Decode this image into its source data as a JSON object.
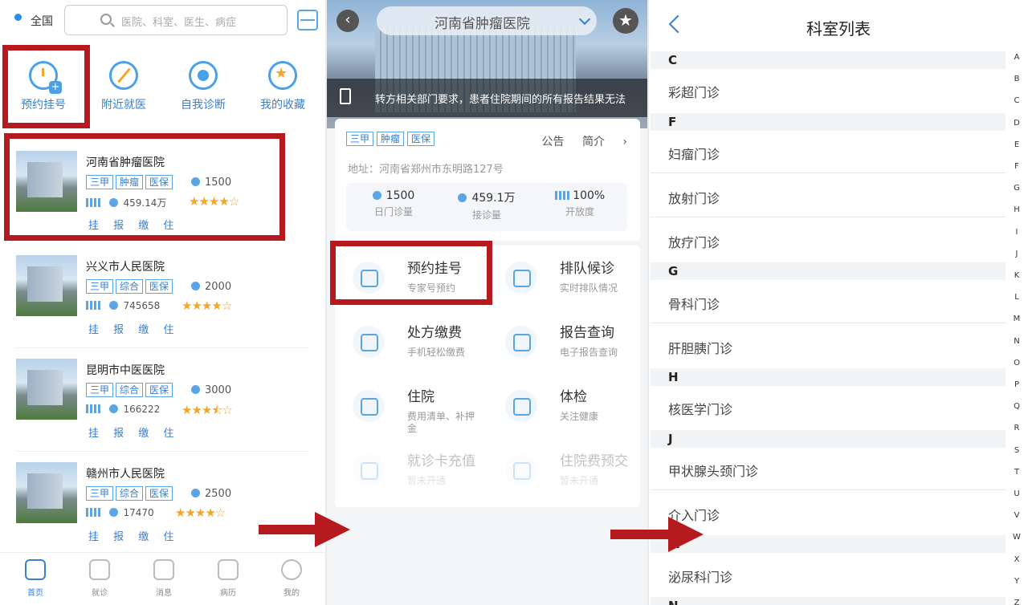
{
  "panel1": {
    "location": "全国",
    "search_placeholder": "医院、科室、医生、病症",
    "quick": [
      {
        "label": "预约挂号",
        "icon": "clock-plus-icon"
      },
      {
        "label": "附近就医",
        "icon": "compass-icon"
      },
      {
        "label": "自我诊断",
        "icon": "target-icon"
      },
      {
        "label": "我的收藏",
        "icon": "star-icon"
      }
    ],
    "hospitals": [
      {
        "name": "河南省肿瘤医院",
        "tags": [
          "三甲",
          "肿瘤",
          "医保"
        ],
        "visits": "1500",
        "count": "459.14万",
        "stars": "★★★★☆",
        "actions": "挂 报 缴 住"
      },
      {
        "name": "兴义市人民医院",
        "tags": [
          "三甲",
          "综合",
          "医保"
        ],
        "visits": "2000",
        "count": "745658",
        "stars": "★★★★☆",
        "actions": "挂 报 缴 住"
      },
      {
        "name": "昆明市中医医院",
        "tags": [
          "三甲",
          "综合",
          "医保"
        ],
        "visits": "3000",
        "count": "166222",
        "stars": "★★★⯪☆",
        "actions": "挂 报 缴 住"
      },
      {
        "name": "赣州市人民医院",
        "tags": [
          "三甲",
          "综合",
          "医保"
        ],
        "visits": "2500",
        "count": "17470",
        "stars": "★★★★☆",
        "actions": "挂 报 缴 住"
      }
    ],
    "tabs": [
      "首页",
      "就诊",
      "消息",
      "病历",
      "我的"
    ]
  },
  "panel2": {
    "title": "河南省肿瘤医院",
    "notice": "转方相关部门要求，患者住院期间的所有报告结果无法",
    "tags": [
      "三甲",
      "肿瘤",
      "医保"
    ],
    "links": "公告 简介 ›",
    "address": "地址：河南省郑州市东明路127号",
    "stats": [
      {
        "value": "1500",
        "label": "日门诊量"
      },
      {
        "value": "459.1万",
        "label": "接诊量"
      },
      {
        "value": "100%",
        "label": "开放度"
      }
    ],
    "services": [
      {
        "title": "预约挂号",
        "sub": "专家号预约"
      },
      {
        "title": "排队候诊",
        "sub": "实时排队情况"
      },
      {
        "title": "处方缴费",
        "sub": "手机轻松缴费"
      },
      {
        "title": "报告查询",
        "sub": "电子报告查询"
      },
      {
        "title": "住院",
        "sub": "费用清单、补押金"
      },
      {
        "title": "体检",
        "sub": "关注健康"
      },
      {
        "title": "就诊卡充值",
        "sub": "暂未开通"
      },
      {
        "title": "住院费预交",
        "sub": "暂未开通"
      }
    ]
  },
  "panel3": {
    "title": "科室列表",
    "sections": [
      {
        "letter": "C",
        "items": [
          "彩超门诊"
        ]
      },
      {
        "letter": "F",
        "items": [
          "妇瘤门诊",
          "放射门诊",
          "放疗门诊"
        ]
      },
      {
        "letter": "G",
        "items": [
          "骨科门诊",
          "肝胆胰门诊"
        ]
      },
      {
        "letter": "H",
        "items": [
          "核医学门诊"
        ]
      },
      {
        "letter": "J",
        "items": [
          "甲状腺头颈门诊",
          "介入门诊"
        ]
      },
      {
        "letter": "M",
        "items": [
          "泌尿科门诊"
        ]
      },
      {
        "letter": "N",
        "items": []
      }
    ],
    "index": [
      "A",
      "B",
      "C",
      "D",
      "E",
      "F",
      "G",
      "H",
      "I",
      "J",
      "K",
      "L",
      "M",
      "N",
      "O",
      "P",
      "Q",
      "R",
      "S",
      "T",
      "U",
      "V",
      "W",
      "X",
      "Y",
      "Z"
    ]
  },
  "colors": {
    "accent": "#3a7fd0",
    "highlight": "#b51a1e",
    "star": "#f5a623"
  }
}
